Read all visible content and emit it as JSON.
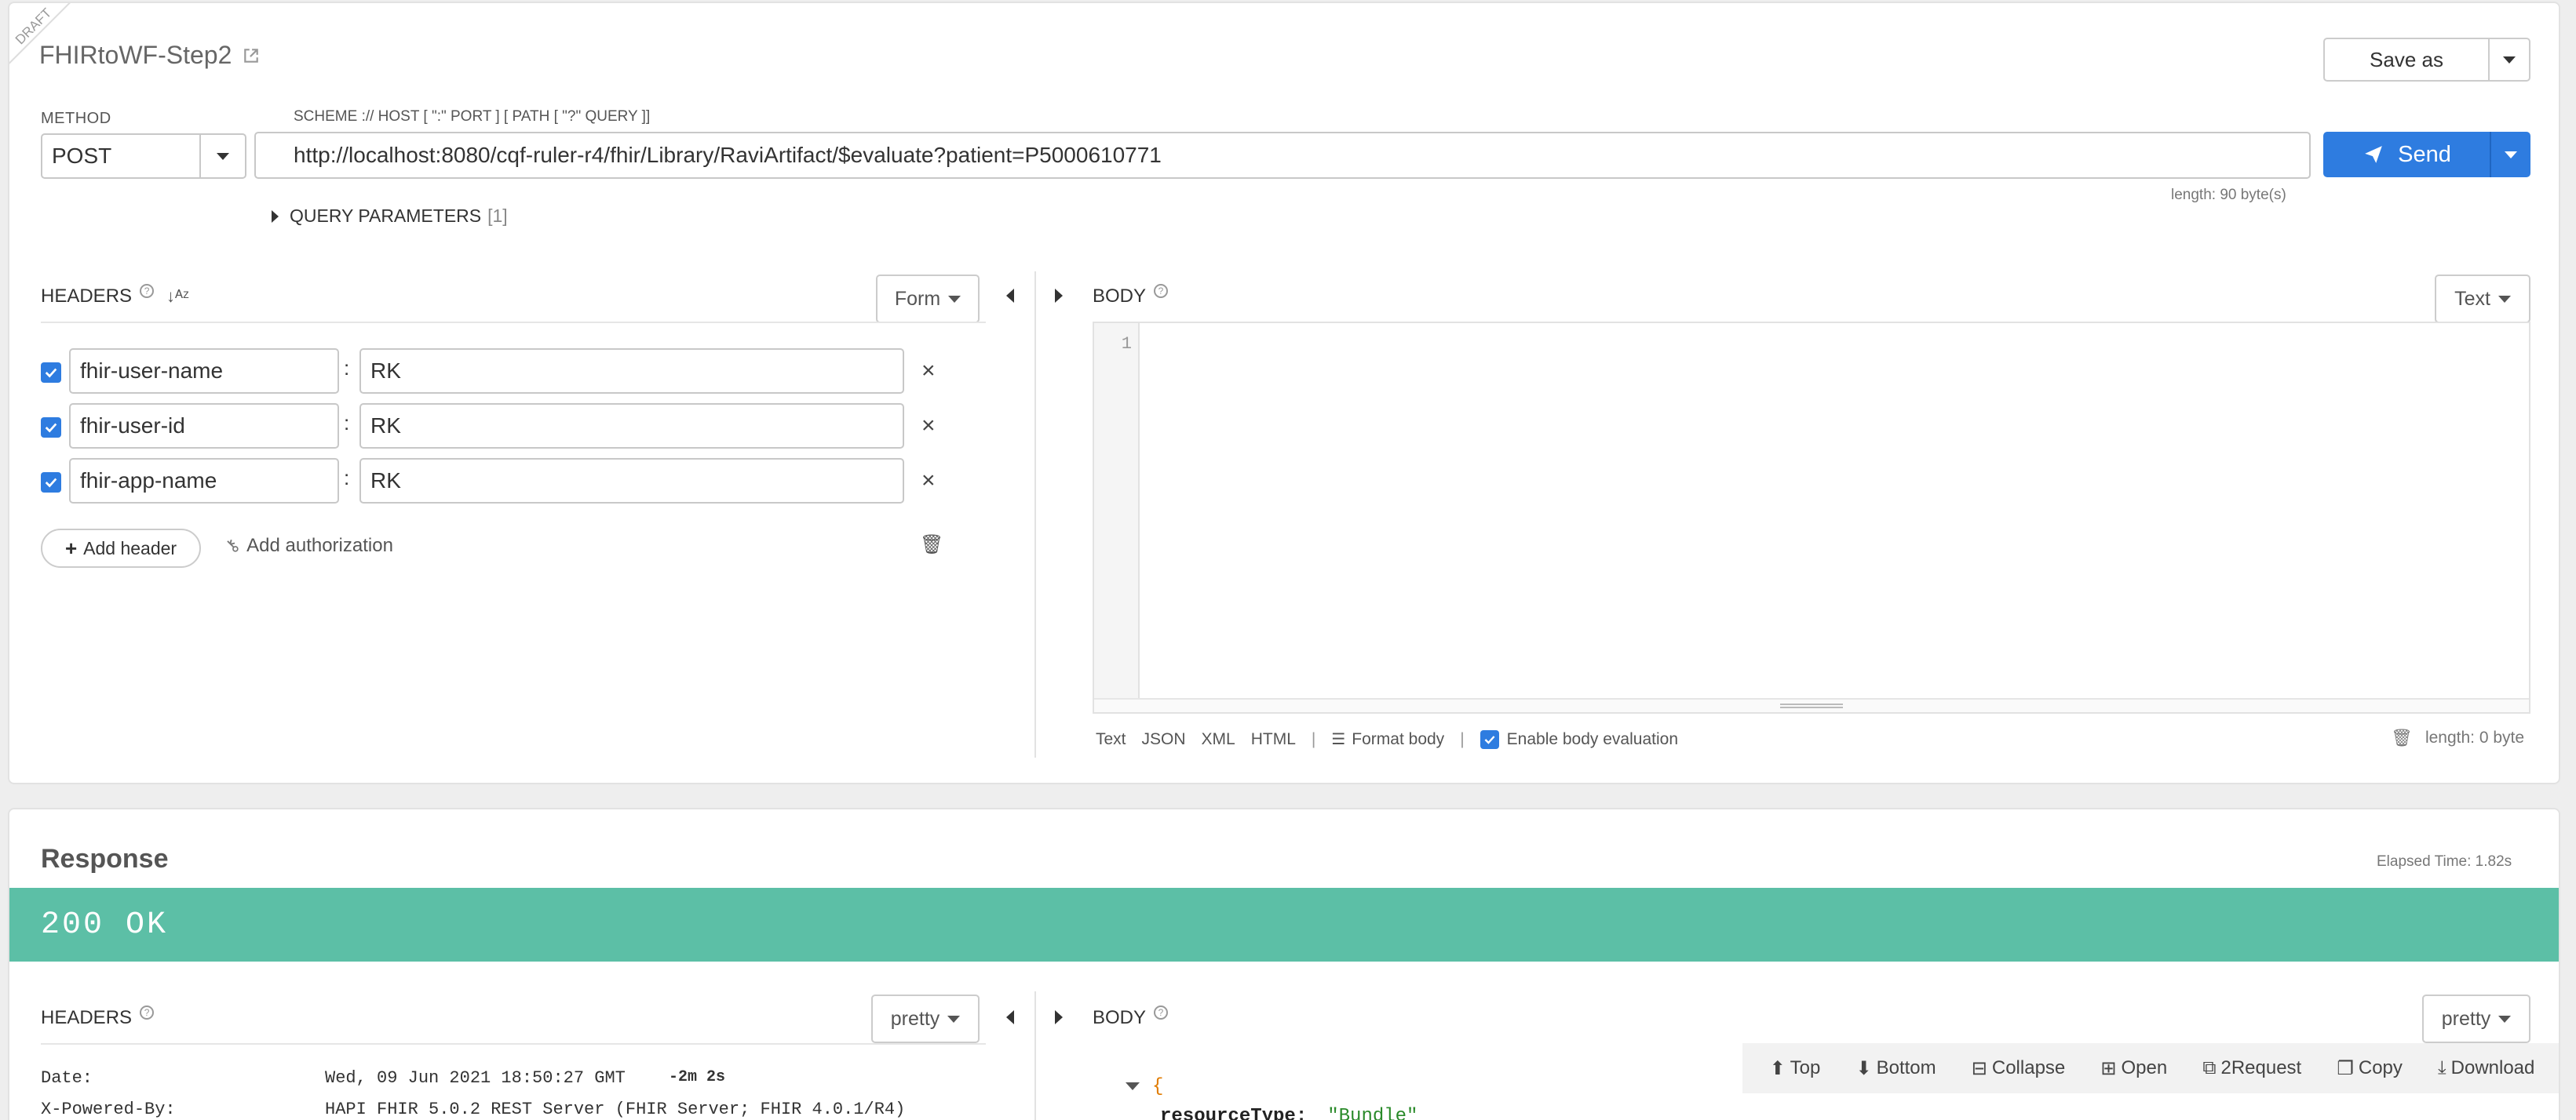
{
  "request": {
    "draft_label": "DRAFT",
    "title": "FHIRtoWF-Step2",
    "save_as_label": "Save as",
    "method_label": "METHOD",
    "method_value": "POST",
    "url_label": "SCHEME :// HOST [ \":\" PORT ] [ PATH [ \"?\" QUERY ]]",
    "url_value": "http://localhost:8080/cqf-ruler-r4/fhir/Library/RaviArtifact/$evaluate?patient=P5000610771",
    "url_length": "length: 90 byte(s)",
    "send_label": "Send",
    "query_params_label": "QUERY PARAMETERS",
    "query_params_count": "[1]",
    "headers_label": "HEADERS",
    "headers_mode": "Form",
    "headers": [
      {
        "name": "fhir-user-name",
        "value": "RK"
      },
      {
        "name": "fhir-user-id",
        "value": "RK"
      },
      {
        "name": "fhir-app-name",
        "value": "RK"
      }
    ],
    "add_header_label": "Add header",
    "add_authorization_label": "Add authorization",
    "body_label": "BODY",
    "body_mode": "Text",
    "body_line_number": "1",
    "body_formats": [
      "Text",
      "JSON",
      "XML",
      "HTML"
    ],
    "format_body_label": "Format body",
    "enable_body_eval_label": "Enable body evaluation",
    "body_length": "length: 0 byte"
  },
  "response": {
    "title": "Response",
    "elapsed": "Elapsed Time: 1.82s",
    "status": "200 OK",
    "status_color": "#5cbfa6",
    "headers_label": "HEADERS",
    "headers_mode": "pretty",
    "headers": [
      {
        "name": "Date:",
        "value": "Wed, 09 Jun 2021 18:50:27 GMT",
        "extra": "-2m 2s"
      },
      {
        "name": "X-Powered-By:",
        "value": "HAPI FHIR 5.0.2 REST Server (FHIR Server; FHIR 4.0.1/R4)",
        "extra": ""
      }
    ],
    "body_label": "BODY",
    "body_mode": "pretty",
    "toolbar": [
      "Top",
      "Bottom",
      "Collapse",
      "Open",
      "2Request",
      "Copy",
      "Download"
    ],
    "json_open_brace": "{",
    "json_key": "resourceType:",
    "json_value": "\"Bundle\""
  },
  "colors": {
    "accent": "#2e7ce0",
    "success": "#5cbfa6"
  }
}
